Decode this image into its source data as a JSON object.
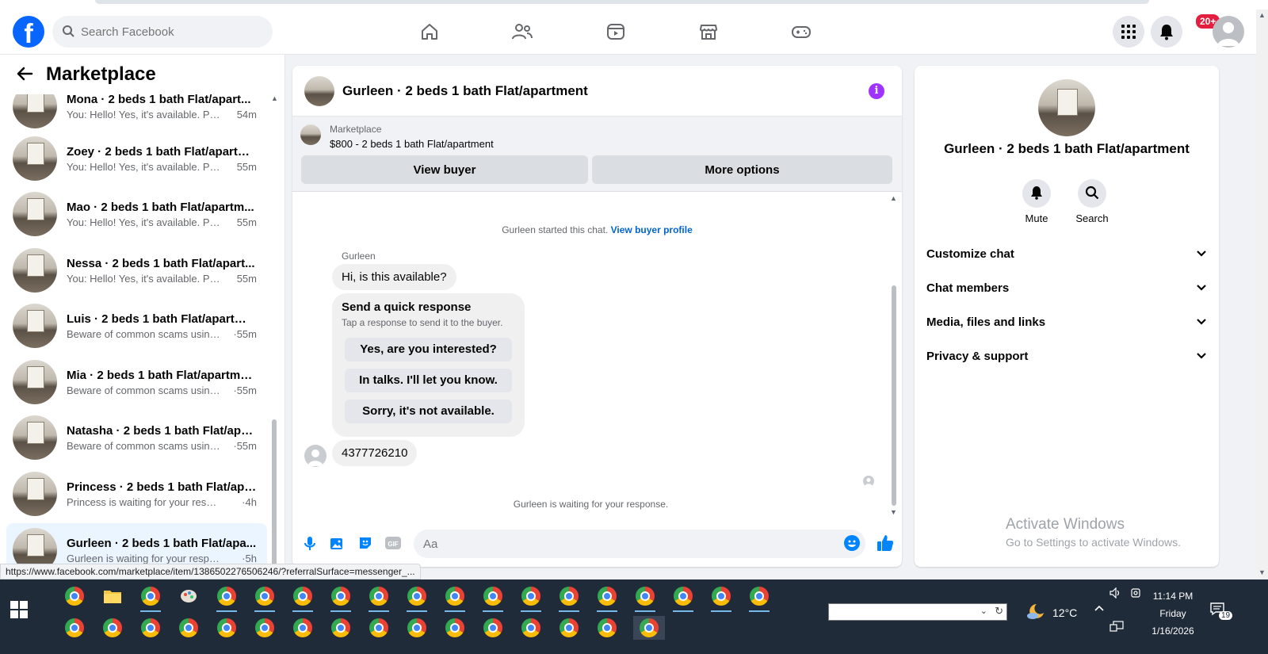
{
  "topbar": {
    "logo": "f",
    "search_placeholder": "Search Facebook",
    "notif_badge": "20+",
    "nav_icons": [
      "home-icon",
      "friends-icon",
      "video-icon",
      "marketplace-icon",
      "gaming-icon"
    ]
  },
  "sidebar": {
    "title": "Marketplace",
    "conversations": [
      {
        "name": "Mona · 2 beds 1 bath Flat/apart...",
        "snippet": "You: Hello! Yes, it's available. Plea...",
        "time": "54m"
      },
      {
        "name": "Zoey · 2 beds 1 bath Flat/apartm...",
        "snippet": "You: Hello! Yes, it's available. Plea...",
        "time": "55m"
      },
      {
        "name": "Mao · 2 beds 1 bath Flat/apartm...",
        "snippet": "You: Hello! Yes, it's available. Plea...",
        "time": "55m"
      },
      {
        "name": "Nessa · 2 beds 1 bath Flat/apart...",
        "snippet": "You: Hello! Yes, it's available. Plea...",
        "time": "55m"
      },
      {
        "name": "Luis · 2 beds 1 bath Flat/apartme...",
        "snippet": "Beware of common scams using ...",
        "time": "·55m"
      },
      {
        "name": "Mia · 2 beds 1 bath Flat/apartme...",
        "snippet": "Beware of common scams using ...",
        "time": "·55m"
      },
      {
        "name": "Natasha · 2 beds 1 bath Flat/apa...",
        "snippet": "Beware of common scams using ...",
        "time": "·55m"
      },
      {
        "name": "Princess · 2 beds 1 bath Flat/apa...",
        "snippet": "Princess is waiting for your response.",
        "time": "·4h"
      },
      {
        "name": "Gurleen · 2 beds 1 bath Flat/apa...",
        "snippet": "Gurleen is waiting for your response.",
        "time": "·5h"
      }
    ]
  },
  "chat": {
    "title": "Gurleen · 2 beds 1 bath Flat/apartment",
    "listing_category": "Marketplace",
    "listing_price": "$800 - 2 beds 1 bath Flat/apartment",
    "view_buyer": "View buyer",
    "more_options": "More options",
    "started_text": "Gurleen started this chat.",
    "view_profile": "View buyer profile",
    "sender": "Gurleen",
    "message1": "Hi, is this available?",
    "quick_title": "Send a quick response",
    "quick_sub": "Tap a response to send it to the buyer.",
    "quick_replies": [
      "Yes, are you interested?",
      "In talks. I'll let you know.",
      "Sorry, it's not available."
    ],
    "message2": "4377726210",
    "waiting": "Gurleen is waiting for your response.",
    "composer_placeholder": "Aa"
  },
  "info_panel": {
    "name": "Gurleen · 2 beds 1 bath Flat/apartment",
    "mute": "Mute",
    "search": "Search",
    "sections": [
      "Customize chat",
      "Chat members",
      "Media, files and links",
      "Privacy & support"
    ]
  },
  "watermark": {
    "line1": "Activate Windows",
    "line2": "Go to Settings to activate Windows."
  },
  "status_url": "https://www.facebook.com/marketplace/item/1386502276506246/?referralSurface=messenger_...",
  "taskbar": {
    "temperature": "12°C",
    "time": "11:14 PM",
    "day": "Friday",
    "date": "1/16/2026",
    "notif_count": "19"
  },
  "colors": {
    "brand": "#0866ff",
    "accent": "#0084ff",
    "badge": "#e41e3f",
    "info": "#a033ff"
  }
}
